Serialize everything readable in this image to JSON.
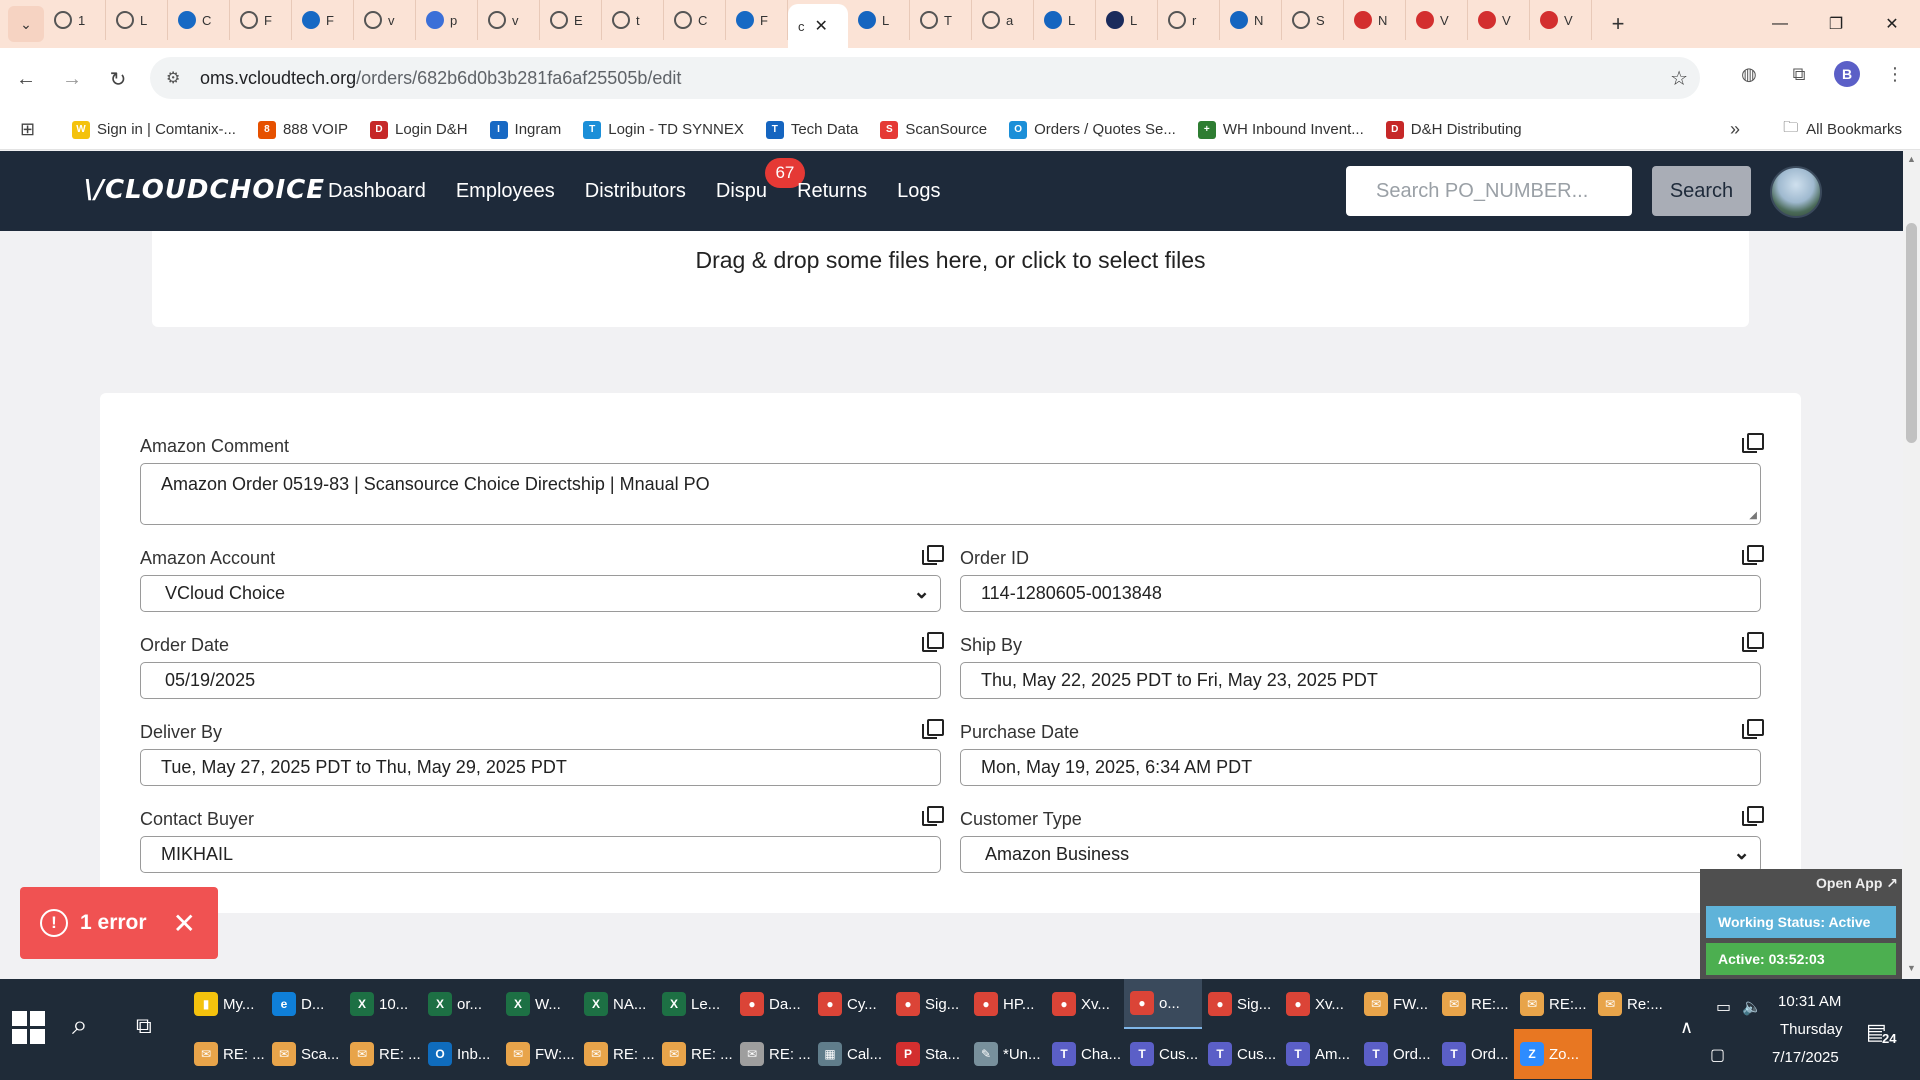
{
  "browser": {
    "tabs": [
      {
        "label": "1",
        "icon": "globe",
        "color": "#555555"
      },
      {
        "label": "L",
        "icon": "globe",
        "color": "#555555"
      },
      {
        "label": "C",
        "icon": "ingram",
        "color": "#1769c4"
      },
      {
        "label": "F",
        "icon": "globe",
        "color": "#555555"
      },
      {
        "label": "F",
        "icon": "chevron",
        "color": "#1769c4"
      },
      {
        "label": "v",
        "icon": "globe",
        "color": "#555555"
      },
      {
        "label": "p",
        "icon": "pencil",
        "color": "#3b6fd8"
      },
      {
        "label": "v",
        "icon": "globe",
        "color": "#555555"
      },
      {
        "label": "E",
        "icon": "globe",
        "color": "#555555"
      },
      {
        "label": "t",
        "icon": "globe",
        "color": "#555555"
      },
      {
        "label": "C",
        "icon": "globe",
        "color": "#555555"
      },
      {
        "label": "F",
        "icon": "link",
        "color": "#1769c4"
      },
      {
        "label": "c",
        "icon": "active",
        "color": "#333333"
      },
      {
        "label": "L",
        "icon": "u-box",
        "color": "#1565c0"
      },
      {
        "label": "T",
        "icon": "globe",
        "color": "#555555"
      },
      {
        "label": "a",
        "icon": "globe",
        "color": "#555555"
      },
      {
        "label": "L",
        "icon": "td",
        "color": "#1565c0"
      },
      {
        "label": "L",
        "icon": "check",
        "color": "#1a2b5c"
      },
      {
        "label": "r",
        "icon": "globe",
        "color": "#555555"
      },
      {
        "label": "N",
        "icon": "etn",
        "color": "#1565c0"
      },
      {
        "label": "S",
        "icon": "globe",
        "color": "#555555"
      },
      {
        "label": "N",
        "icon": "shield",
        "color": "#d32f2f"
      },
      {
        "label": "V",
        "icon": "shield",
        "color": "#d32f2f"
      },
      {
        "label": "V",
        "icon": "shield",
        "color": "#d32f2f"
      },
      {
        "label": "V",
        "icon": "shield",
        "color": "#d32f2f"
      }
    ],
    "url_host": "oms.vcloudtech.org",
    "url_path": "/orders/682b6d0b3b281fa6af25505b/edit",
    "profile_initial": "B"
  },
  "bookmarks": [
    {
      "label": "Sign in | Comtanix-...",
      "color": "#f4c20d",
      "glyph": "W"
    },
    {
      "label": "888 VOIP",
      "color": "#e65100",
      "glyph": "8"
    },
    {
      "label": "Login D&H",
      "color": "#c62828",
      "glyph": "D"
    },
    {
      "label": "Ingram",
      "color": "#1769c4",
      "glyph": "I"
    },
    {
      "label": "Login - TD SYNNEX",
      "color": "#1b8fd8",
      "glyph": "T"
    },
    {
      "label": "Tech Data",
      "color": "#1565c0",
      "glyph": "T"
    },
    {
      "label": "ScanSource",
      "color": "#e53935",
      "glyph": "S"
    },
    {
      "label": "Orders / Quotes Se...",
      "color": "#1b8fd8",
      "glyph": "O"
    },
    {
      "label": "WH Inbound Invent...",
      "color": "#2e7d32",
      "glyph": "+"
    },
    {
      "label": "D&H Distributing",
      "color": "#c62828",
      "glyph": "D"
    }
  ],
  "bookmarks_all": "All Bookmarks",
  "app": {
    "logo": "CLOUDCHOICE",
    "nav": {
      "dashboard": "Dashboard",
      "employees": "Employees",
      "distributors": "Distributors",
      "disputes": "Dispu",
      "disputes_count": "67",
      "returns": "Returns",
      "logs": "Logs"
    },
    "search_placeholder": "Search PO_NUMBER...",
    "search_button": "Search"
  },
  "dropzone_text": "Drag & drop some files here, or click to select files",
  "form": {
    "amazon_comment_label": "Amazon Comment",
    "amazon_comment_value": "Amazon Order 0519-83 | Scansource Choice Directship | Mnaual PO",
    "amazon_account_label": "Amazon Account",
    "amazon_account_value": "VCloud Choice",
    "order_id_label": "Order ID",
    "order_id_value": "114-1280605-0013848",
    "order_date_label": "Order Date",
    "order_date_value": "05/19/2025",
    "ship_by_label": "Ship By",
    "ship_by_value": "Thu, May 22, 2025 PDT to Fri, May 23, 2025 PDT",
    "deliver_by_label": "Deliver By",
    "deliver_by_value": "Tue, May 27, 2025 PDT to Thu, May 29, 2025 PDT",
    "purchase_date_label": "Purchase Date",
    "purchase_date_value": "Mon, May 19, 2025, 6:34 AM PDT",
    "contact_buyer_label": "Contact Buyer",
    "contact_buyer_value": "MIKHAIL",
    "customer_type_label": "Customer Type",
    "customer_type_value": "Amazon Business"
  },
  "error_toast": {
    "text": "1 error"
  },
  "timer": {
    "open_app": "Open App ↗",
    "working_status": "Working Status: Active",
    "active_time": "Active: 03:52:03"
  },
  "taskbar": {
    "row1": [
      {
        "label": "My...",
        "color": "#f4c20d",
        "glyph": "▮"
      },
      {
        "label": "D...",
        "color": "#0f7fd8",
        "glyph": "e"
      },
      {
        "label": "10...",
        "color": "#1d7044",
        "glyph": "X"
      },
      {
        "label": "or...",
        "color": "#1d7044",
        "glyph": "X"
      },
      {
        "label": "W...",
        "color": "#1d7044",
        "glyph": "X"
      },
      {
        "label": "NA...",
        "color": "#1d7044",
        "glyph": "X"
      },
      {
        "label": "Le...",
        "color": "#1d7044",
        "glyph": "X"
      },
      {
        "label": "Da...",
        "color": "#db4437",
        "glyph": "●"
      },
      {
        "label": "Cy...",
        "color": "#db4437",
        "glyph": "●"
      },
      {
        "label": "Sig...",
        "color": "#db4437",
        "glyph": "●"
      },
      {
        "label": "HP...",
        "color": "#db4437",
        "glyph": "●"
      },
      {
        "label": "Xv...",
        "color": "#db4437",
        "glyph": "●"
      },
      {
        "label": "o...",
        "color": "#db4437",
        "glyph": "●"
      },
      {
        "label": "Sig...",
        "color": "#db4437",
        "glyph": "●"
      },
      {
        "label": "Xv...",
        "color": "#db4437",
        "glyph": "●"
      },
      {
        "label": "FW...",
        "color": "#e8a44a",
        "glyph": "✉"
      },
      {
        "label": "RE:...",
        "color": "#e8a44a",
        "glyph": "✉"
      },
      {
        "label": "RE:...",
        "color": "#e8a44a",
        "glyph": "✉"
      },
      {
        "label": "Re:...",
        "color": "#e8a44a",
        "glyph": "✉"
      }
    ],
    "row2": [
      {
        "label": "RE: ...",
        "color": "#e8a44a",
        "glyph": "✉"
      },
      {
        "label": "Sca...",
        "color": "#e8a44a",
        "glyph": "✉"
      },
      {
        "label": "RE: ...",
        "color": "#e8a44a",
        "glyph": "✉"
      },
      {
        "label": "Inb...",
        "color": "#0f6cbd",
        "glyph": "O"
      },
      {
        "label": "FW:...",
        "color": "#e8a44a",
        "glyph": "✉"
      },
      {
        "label": "RE: ...",
        "color": "#e8a44a",
        "glyph": "✉"
      },
      {
        "label": "RE: ...",
        "color": "#e8a44a",
        "glyph": "✉"
      },
      {
        "label": "RE: ...",
        "color": "#9e9e9e",
        "glyph": "✉"
      },
      {
        "label": "Cal...",
        "color": "#607d8b",
        "glyph": "▦"
      },
      {
        "label": "Sta...",
        "color": "#d32f2f",
        "glyph": "P"
      },
      {
        "label": "*Un...",
        "color": "#78909c",
        "glyph": "✎"
      },
      {
        "label": "Cha...",
        "color": "#5b5fc7",
        "glyph": "T"
      },
      {
        "label": "Cus...",
        "color": "#5b5fc7",
        "glyph": "T"
      },
      {
        "label": "Cus...",
        "color": "#5b5fc7",
        "glyph": "T"
      },
      {
        "label": "Am...",
        "color": "#5b5fc7",
        "glyph": "T"
      },
      {
        "label": "Ord...",
        "color": "#5b5fc7",
        "glyph": "T"
      },
      {
        "label": "Ord...",
        "color": "#5b5fc7",
        "glyph": "T"
      },
      {
        "label": "Zo...",
        "color": "#2d8cff",
        "glyph": "Z"
      }
    ],
    "clock_time": "10:31 AM",
    "clock_day": "Thursday",
    "clock_date": "7/17/2025",
    "notification_count": "24"
  }
}
